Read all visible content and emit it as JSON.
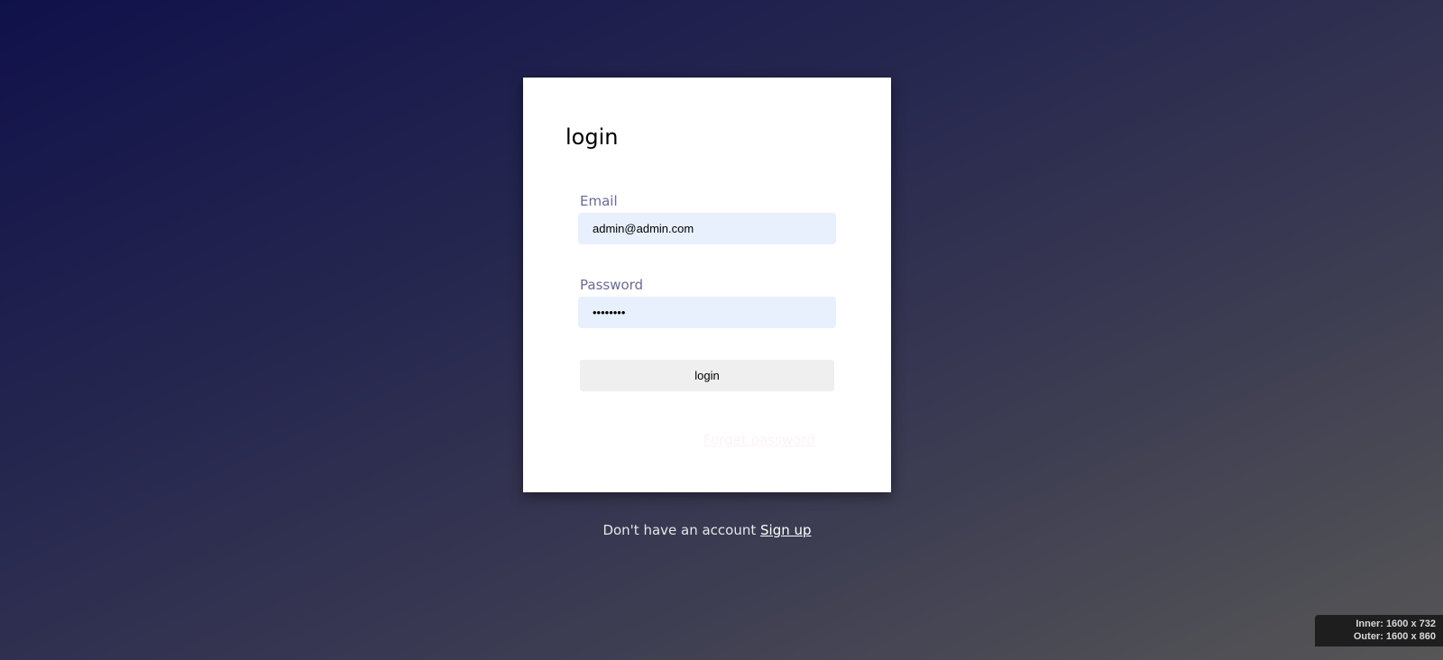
{
  "login_card": {
    "title": "login",
    "email_label": "Email",
    "email_value": "admin@admin.com",
    "password_label": "Password",
    "password_value": "••••••••",
    "login_button": "login",
    "forgot_link": "Forget password"
  },
  "footer": {
    "text": "Don't have an account",
    "signup_link": "Sign up"
  },
  "viewport_overlay": {
    "inner": "Inner: 1600 x 732",
    "outer": "Outer: 1600 x 860"
  }
}
